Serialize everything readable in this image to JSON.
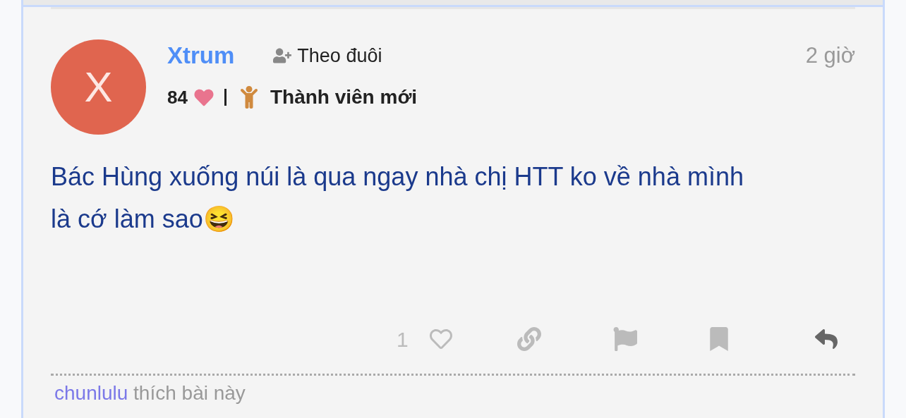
{
  "post": {
    "author": {
      "initial": "X",
      "name": "Xtrum",
      "likes_received": "84",
      "title": "Thành viên mới"
    },
    "follow_label": "Theo đuôi",
    "time": "2 giờ",
    "body": "Bác Hùng xuống núi là qua ngay nhà chị HTT ko về nhà mình là cớ làm sao😆",
    "like_count": "1",
    "liked": false,
    "liked_by": {
      "user": "chunlulu",
      "text": "thích bài này"
    }
  }
}
